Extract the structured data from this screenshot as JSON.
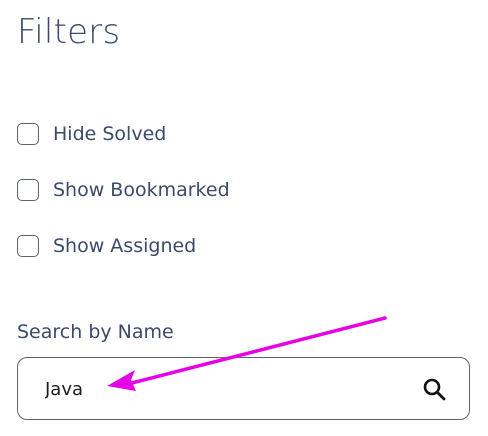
{
  "page": {
    "title": "Filters"
  },
  "filters": [
    {
      "label": "Hide Solved",
      "checked": false
    },
    {
      "label": "Show Bookmarked",
      "checked": false
    },
    {
      "label": "Show Assigned",
      "checked": false
    }
  ],
  "search": {
    "label": "Search by Name",
    "value": "Java",
    "button_icon": "search-icon"
  },
  "annotation": {
    "icon": "arrow-icon",
    "color": "#e600e6"
  },
  "colors": {
    "text": "#3b4a6b",
    "border": "#5c6470",
    "input_text": "#1c1c1c"
  }
}
